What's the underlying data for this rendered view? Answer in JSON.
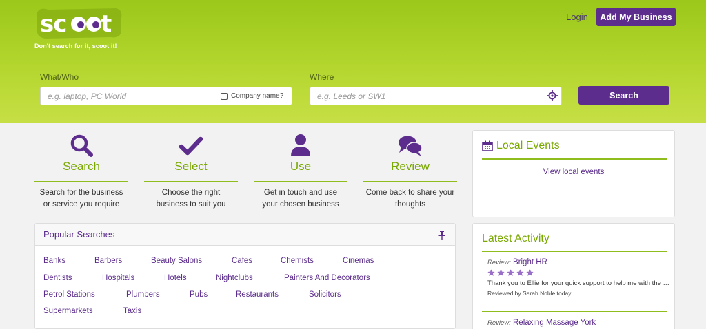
{
  "header": {
    "logo_text": "scoot",
    "tagline": "Don't search for it, scoot it!",
    "login_label": "Login",
    "add_business_label": "Add My Business"
  },
  "search": {
    "what_label": "What/Who",
    "what_placeholder": "e.g. laptop, PC World",
    "company_checkbox_label": "Company name?",
    "where_label": "Where",
    "where_placeholder": "e.g. Leeds or SW1",
    "button_label": "Search"
  },
  "steps": [
    {
      "icon": "search-icon",
      "title": "Search",
      "desc1": "Search for the business",
      "desc2": "or service you require"
    },
    {
      "icon": "check-icon",
      "title": "Select",
      "desc1": "Choose the right",
      "desc2": "business to suit you"
    },
    {
      "icon": "user-icon",
      "title": "Use",
      "desc1": "Get in touch and use",
      "desc2": "your chosen business"
    },
    {
      "icon": "chat-bubbles-icon",
      "title": "Review",
      "desc1": "Come back to share your",
      "desc2": "thoughts"
    }
  ],
  "popular": {
    "title": "Popular Searches",
    "links": [
      "Banks",
      "Barbers",
      "Beauty Salons",
      "Cafes",
      "Chemists",
      "Cinemas",
      "Dentists",
      "Hospitals",
      "Hotels",
      "Nightclubs",
      "Painters And Decorators",
      "Petrol Stations",
      "Plumbers",
      "Pubs",
      "Restaurants",
      "Solicitors",
      "Supermarkets",
      "Taxis"
    ]
  },
  "events": {
    "title": "Local Events",
    "link": "View local events"
  },
  "activity": {
    "title": "Latest Activity",
    "items": [
      {
        "prefix": "Review:",
        "name": "Bright HR",
        "rating": 5,
        "text": "Thank you to Ellie for your quick support to help me with the dashboard",
        "by": "Reviewed by Sarah Noble today"
      },
      {
        "prefix": "Review:",
        "name": "Relaxing Massage York"
      }
    ]
  },
  "colors": {
    "brand_green": "#9bc81a",
    "brand_purple": "#5c2d8c",
    "accent_green_text": "#7aa800"
  }
}
